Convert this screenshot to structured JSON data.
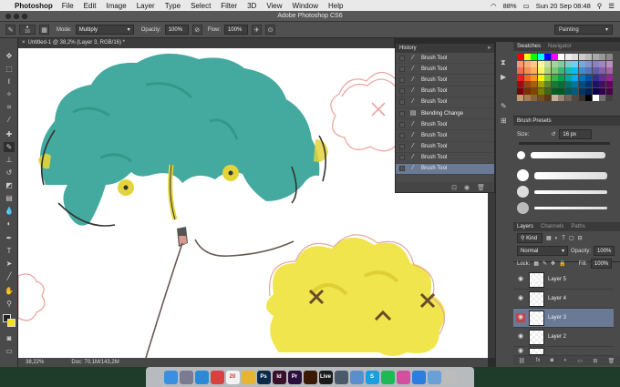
{
  "menubar": {
    "app": "Photoshop",
    "items": [
      "File",
      "Edit",
      "Image",
      "Layer",
      "Type",
      "Select",
      "Filter",
      "3D",
      "View",
      "Window",
      "Help"
    ],
    "battery": "88%",
    "clock": "Sun 20 Sep  08:48"
  },
  "window": {
    "title": "Adobe Photoshop CS6"
  },
  "options": {
    "brush_size": "16",
    "mode_label": "Mode:",
    "mode_value": "Multiply",
    "opacity_label": "Opacity:",
    "opacity_value": "100%",
    "flow_label": "Flow:",
    "flow_value": "100%",
    "workspace": "Painting"
  },
  "document": {
    "tab_title": "Untitled-1 @ 38,2% (Layer 3, RGB/16) *",
    "zoom": "38,22%",
    "doc_info": "Doc: 70,1M/143,2M"
  },
  "history": {
    "title": "History",
    "rows": [
      {
        "label": "Brush Tool",
        "icon": "brush-icon"
      },
      {
        "label": "Brush Tool",
        "icon": "brush-icon"
      },
      {
        "label": "Brush Tool",
        "icon": "brush-icon"
      },
      {
        "label": "Brush Tool",
        "icon": "brush-icon"
      },
      {
        "label": "Brush Tool",
        "icon": "brush-icon"
      },
      {
        "label": "Blending Change",
        "icon": "blend-icon"
      },
      {
        "label": "Brush Tool",
        "icon": "brush-icon"
      },
      {
        "label": "Brush Tool",
        "icon": "brush-icon"
      },
      {
        "label": "Brush Tool",
        "icon": "brush-icon"
      },
      {
        "label": "Brush Tool",
        "icon": "brush-icon"
      },
      {
        "label": "Brush Tool",
        "icon": "brush-icon"
      }
    ]
  },
  "swatches": {
    "tab1": "Swatches",
    "tab2": "Navigator"
  },
  "brush_presets": {
    "title": "Brush Presets",
    "size_label": "Size:",
    "size_value": "16 px"
  },
  "layers": {
    "tabs": [
      "Layers",
      "Channels",
      "Paths"
    ],
    "kind": "Kind",
    "blend": "Normal",
    "opacity_label": "Opacity:",
    "opacity_value": "100%",
    "lock_label": "Lock:",
    "fill_label": "Fill:",
    "fill_value": "100%",
    "rows": [
      "Layer 5",
      "Layer 4",
      "Layer 3",
      "Layer 2"
    ]
  },
  "dock": {
    "icons": [
      {
        "name": "finder-icon",
        "label": "",
        "color": "#3a8fe0"
      },
      {
        "name": "launchpad-icon",
        "label": "",
        "color": "#7a7a90"
      },
      {
        "name": "safari-icon",
        "label": "",
        "color": "#2a8ad8"
      },
      {
        "name": "mail-icon",
        "label": "",
        "color": "#d94040"
      },
      {
        "name": "calendar-icon",
        "label": "20",
        "color": "#f2f2f2"
      },
      {
        "name": "photos-icon",
        "label": "",
        "color": "#e9b52f"
      },
      {
        "name": "photoshop-icon",
        "label": "Ps",
        "color": "#0c2b4a"
      },
      {
        "name": "indesign-icon",
        "label": "Id",
        "color": "#3a0f2b"
      },
      {
        "name": "premiere-icon",
        "label": "Pr",
        "color": "#2a0f3a"
      },
      {
        "name": "illustrator-icon",
        "label": "",
        "color": "#3a1a04"
      },
      {
        "name": "live-icon",
        "label": "Live",
        "color": "#1a1a1a"
      },
      {
        "name": "app-icon",
        "label": "",
        "color": "#4a5a6a"
      },
      {
        "name": "gamecenter-icon",
        "label": "",
        "color": "#5a8fcf"
      },
      {
        "name": "skype-icon",
        "label": "S",
        "color": "#1a9ee0"
      },
      {
        "name": "spotify-icon",
        "label": "",
        "color": "#1db954"
      },
      {
        "name": "itunes-icon",
        "label": "",
        "color": "#d44fa0"
      },
      {
        "name": "appstore-icon",
        "label": "",
        "color": "#2a7ee0"
      },
      {
        "name": "folder-icon",
        "label": "",
        "color": "#6aa0d8"
      },
      {
        "name": "trash-icon",
        "label": "",
        "color": "#bcbcbc"
      }
    ]
  }
}
